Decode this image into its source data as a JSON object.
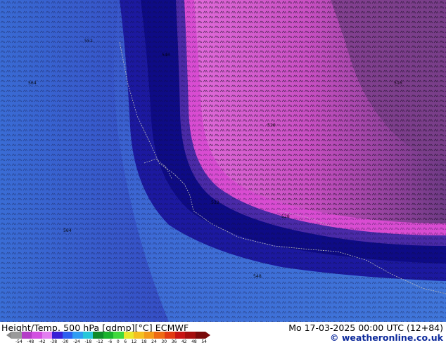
{
  "map": {
    "contour_labels": {
      "far_field": "564",
      "west_field": "552",
      "band_mid": "548",
      "band_inner": "540",
      "ring_outer": "532",
      "ring_inner": "528",
      "core": "520",
      "core_inner": "516"
    },
    "colors": {
      "far_field": "#3c6ad4",
      "west_field": "#3a5fcf",
      "band_mid": "#1c19a0",
      "band_inner": "#0e0b86",
      "ring_outer": "#4a2aa8",
      "ring_inner": "#d94cd2",
      "core": "#c746b9",
      "core_inner": "#7a3e8a",
      "coastline": "#bdbdbd"
    }
  },
  "footer": {
    "product_title": "Height/Temp. 500 hPa [gdmp][°C] ECMWF",
    "valid_time": "Mo 17-03-2025 00:00 UTC (12+84)",
    "credit": "© weatheronline.co.uk"
  },
  "legend": {
    "ticks": [
      "-54",
      "-48",
      "-42",
      "-38",
      "-30",
      "-24",
      "-18",
      "-12",
      "-6",
      "0",
      "6",
      "12",
      "18",
      "24",
      "30",
      "36",
      "42",
      "48",
      "54"
    ],
    "colors": [
      "#9a9a9a",
      "#b43cc7",
      "#d24fe0",
      "#e27ef0",
      "#3a1fd6",
      "#2d5ff0",
      "#2f9cf2",
      "#27c7d9",
      "#0e8a2a",
      "#19b22d",
      "#3fd93b",
      "#e8e82a",
      "#f4c020",
      "#f39a1a",
      "#ee6a14",
      "#e23a12",
      "#c81414",
      "#a50e0e",
      "#7a0a0a"
    ]
  }
}
